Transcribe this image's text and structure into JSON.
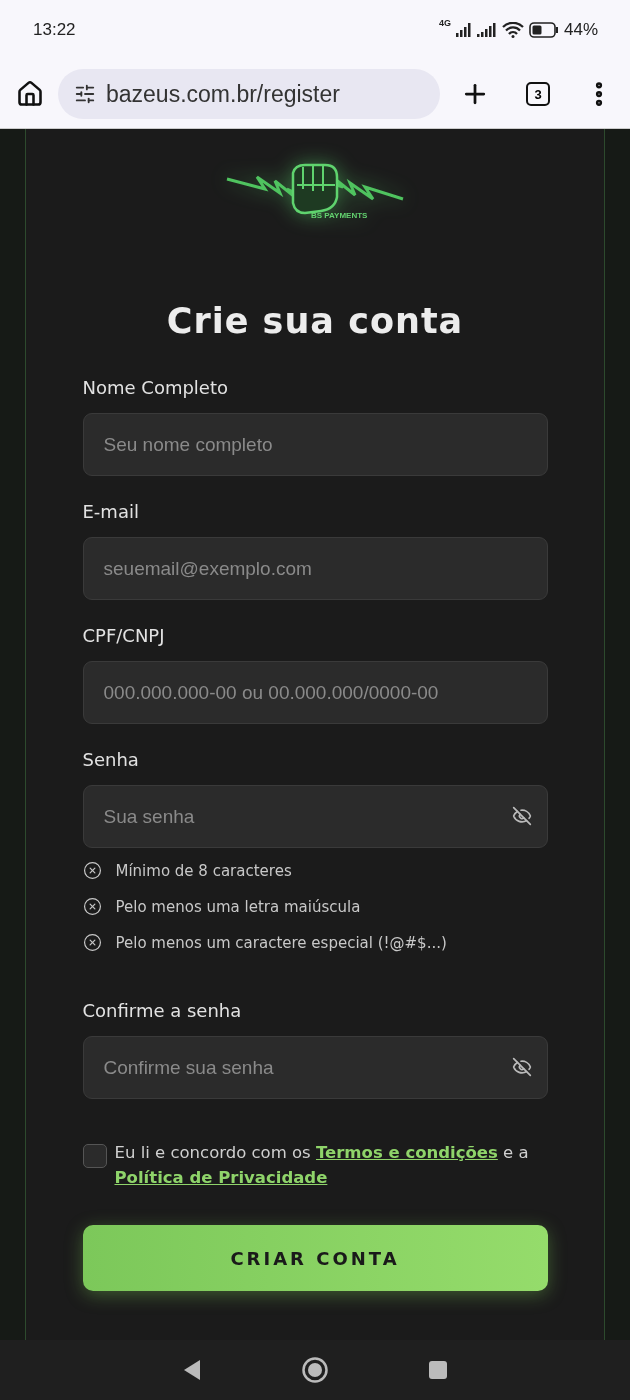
{
  "status_bar": {
    "time": "13:22",
    "network": "4G",
    "battery": "44%"
  },
  "browser": {
    "url": "bazeus.com.br/register",
    "tab_count": "3"
  },
  "logo": {
    "caption": "BS PAYMENTS"
  },
  "title": "Crie sua conta",
  "fields": [
    {
      "label": "Nome Completo",
      "placeholder": "Seu nome completo",
      "kind": "text"
    },
    {
      "label": "E-mail",
      "placeholder": "seuemail@exemplo.com",
      "kind": "text"
    },
    {
      "label": "CPF/CNPJ",
      "placeholder": "000.000.000-00 ou 00.000.000/0000-00",
      "kind": "text"
    },
    {
      "label": "Senha",
      "placeholder": "Sua senha",
      "kind": "password",
      "requirements": [
        {
          "text": "Mínimo de 8 caracteres",
          "met": false
        },
        {
          "text": "Pelo menos uma letra maiúscula",
          "met": false
        },
        {
          "text": "Pelo menos um caractere especial (!@#$...)",
          "met": false
        }
      ]
    },
    {
      "label": "Confirme a senha",
      "placeholder": "Confirme sua senha",
      "kind": "password"
    }
  ],
  "terms": {
    "checked": false,
    "before": "Eu li e concordo com os",
    "link_1": "Termos e condições",
    "middle": "e a",
    "link_2": "Política de Privacidade"
  },
  "submit": "CRIAR CONTA"
}
